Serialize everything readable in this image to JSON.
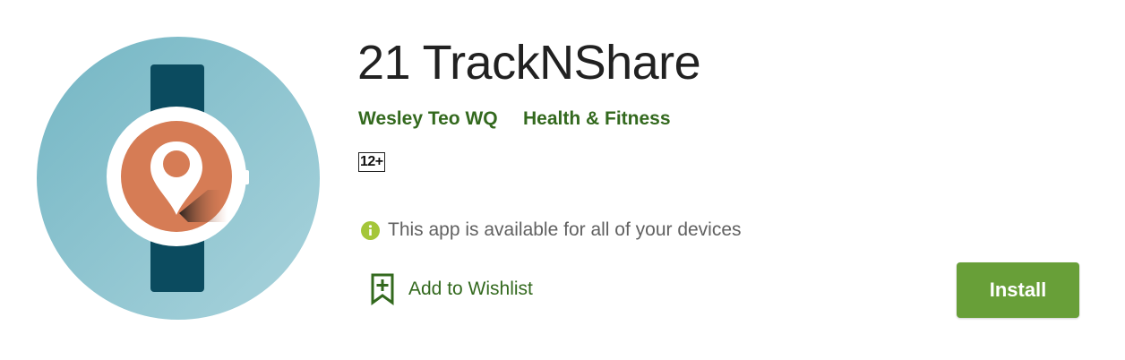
{
  "app": {
    "title": "21 TrackNShare",
    "developer": "Wesley Teo WQ",
    "category": "Health & Fitness",
    "content_rating": "12+",
    "icon": "watch-location-pin-icon"
  },
  "availability": {
    "icon": "info-icon",
    "text": "This app is available for all of your devices"
  },
  "wishlist": {
    "icon": "bookmark-add-icon",
    "label": "Add to Wishlist"
  },
  "install": {
    "label": "Install"
  },
  "colors": {
    "accent_green": "#689f38",
    "link_green": "#33691e",
    "icon_teal": "#87c0cc",
    "icon_orange": "#d67c55",
    "strap_dark": "#0b4b5f",
    "info_yellow_green": "#a4c639"
  }
}
